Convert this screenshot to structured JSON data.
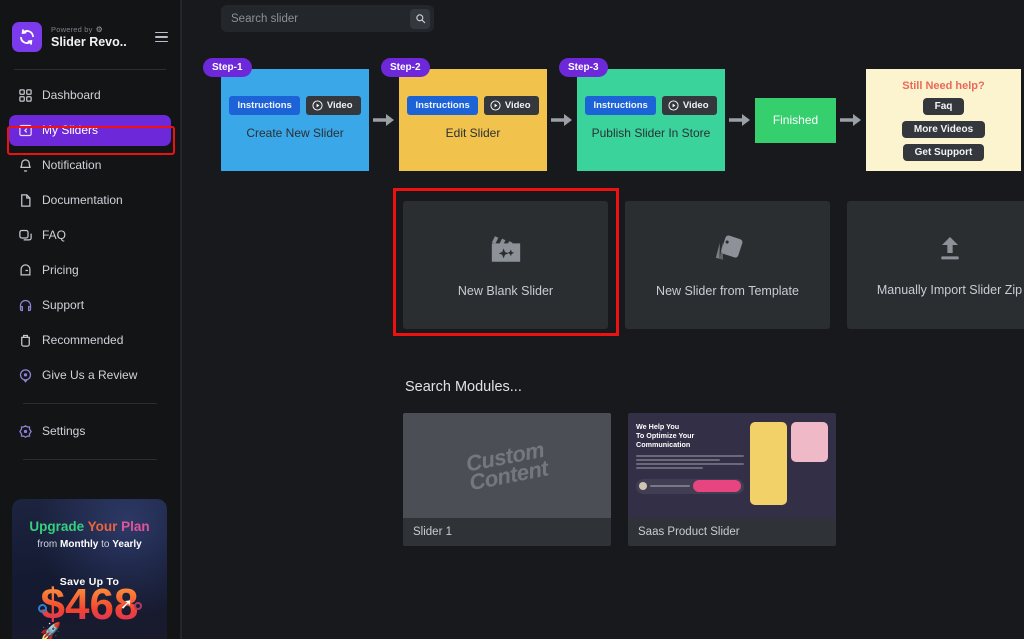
{
  "sidebar": {
    "brand": {
      "powered_by": "Powered by",
      "powered_icon": "wordpress-icon",
      "name": "Slider Revo..",
      "logo_icon": "slider-revolution-logo",
      "menu_icon": "hamburger-icon"
    },
    "items": [
      {
        "label": "Dashboard",
        "icon": "grid-icon",
        "active": false
      },
      {
        "label": "My Sliders",
        "icon": "slider-icon",
        "active": true
      },
      {
        "label": "Notification",
        "icon": "bell-icon",
        "active": false
      },
      {
        "label": "Documentation",
        "icon": "document-icon",
        "active": false
      },
      {
        "label": "FAQ",
        "icon": "question-bubble-icon",
        "active": false
      },
      {
        "label": "Pricing",
        "icon": "tag-icon",
        "active": false
      },
      {
        "label": "Support",
        "icon": "headset-icon",
        "active": false
      },
      {
        "label": "Recommended",
        "icon": "thumbs-up-icon",
        "active": false
      },
      {
        "label": "Give Us a Review",
        "icon": "star-bubble-icon",
        "active": false
      }
    ],
    "settings": {
      "label": "Settings",
      "icon": "gear-icon"
    },
    "promo": {
      "line1_a": "Upgrade ",
      "line1_b": "Your ",
      "line1_c": "Plan",
      "line2_pre": "from ",
      "line2_b1": "Monthly",
      "line2_mid": " to ",
      "line2_b2": "Yearly",
      "save_label": "Save Up To",
      "price": "$468",
      "arrow_icon": "up-arrow-icon",
      "rocket_icon": "rocket-icon"
    }
  },
  "search": {
    "value": "",
    "placeholder": "Search slider",
    "icon": "search-icon"
  },
  "steps": [
    {
      "badge": "Step-1",
      "instructions": "Instructions",
      "video": "Video",
      "title": "Create New Slider",
      "color": "#3aa7e8"
    },
    {
      "badge": "Step-2",
      "instructions": "Instructions",
      "video": "Video",
      "title": "Edit Slider",
      "color": "#f1c24c"
    },
    {
      "badge": "Step-3",
      "instructions": "Instructions",
      "video": "Video",
      "title": "Publish Slider In Store",
      "color": "#3ad39b"
    }
  ],
  "finished": {
    "label": "Finished",
    "color": "#35cf6e"
  },
  "help": {
    "title": "Still Need help?",
    "buttons": [
      "Faq",
      "More Videos",
      "Get Support"
    ]
  },
  "actions": [
    {
      "label": "New Blank Slider",
      "icon": "clapperboard-sparkle-icon",
      "highlighted": true
    },
    {
      "label": "New Slider from Template",
      "icon": "template-cards-icon",
      "highlighted": false
    },
    {
      "label": "Manually Import Slider Zip",
      "icon": "upload-icon",
      "highlighted": false
    }
  ],
  "modules": {
    "heading": "Search Modules...",
    "items": [
      {
        "name": "Slider 1",
        "thumb_type": "custom-content",
        "thumb_text_line1": "Custom",
        "thumb_text_line2": "Content"
      },
      {
        "name": "Saas Product Slider",
        "thumb_type": "saas-preview",
        "thumb_heading": "We Help You\nTo Optimize Your\nCommunication"
      }
    ]
  },
  "colors": {
    "background": "#17191c",
    "sidebar": "#131416",
    "accent_purple": "#6d28d9",
    "highlight_red": "#ee1111",
    "card": "#2b2e31"
  }
}
